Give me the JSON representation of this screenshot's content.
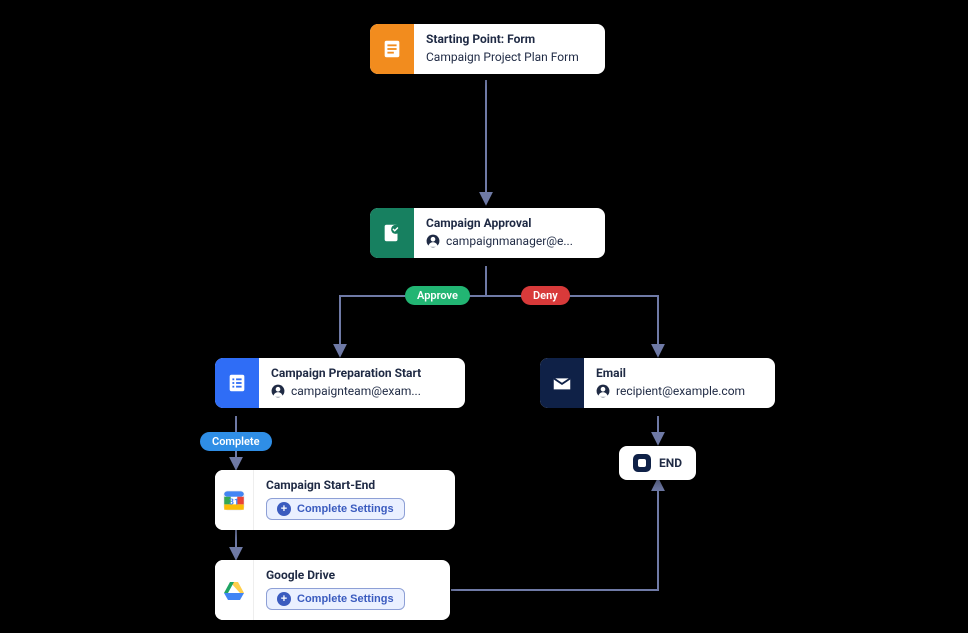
{
  "nodes": {
    "start": {
      "title": "Starting Point: Form",
      "subtitle": "Campaign Project Plan Form",
      "icon": "form-icon",
      "iconBg": "#f28c1e"
    },
    "approval": {
      "title": "Campaign Approval",
      "subtitle": "campaignmanager@e...",
      "icon": "approval-icon",
      "iconBg": "#178060",
      "hasUser": true
    },
    "prep": {
      "title": "Campaign Preparation Start",
      "subtitle": "campaignteam@exam...",
      "icon": "checklist-icon",
      "iconBg": "#2f6df6",
      "hasUser": true
    },
    "email": {
      "title": "Email",
      "subtitle": "recipient@example.com",
      "icon": "email-icon",
      "iconBg": "#0f2147",
      "hasUser": true
    },
    "calendar": {
      "title": "Campaign Start-End",
      "button": "Complete Settings",
      "icon": "calendar-icon"
    },
    "drive": {
      "title": "Google Drive",
      "button": "Complete Settings",
      "icon": "drive-icon"
    },
    "end": {
      "label": "END"
    }
  },
  "pills": {
    "approve": {
      "label": "Approve",
      "color": "#22b573"
    },
    "deny": {
      "label": "Deny",
      "color": "#d83a3a"
    },
    "complete": {
      "label": "Complete",
      "color": "#2f8ee6"
    }
  },
  "connectorColor": "#6f7aa6",
  "arrowColor": "#6f7aa6"
}
